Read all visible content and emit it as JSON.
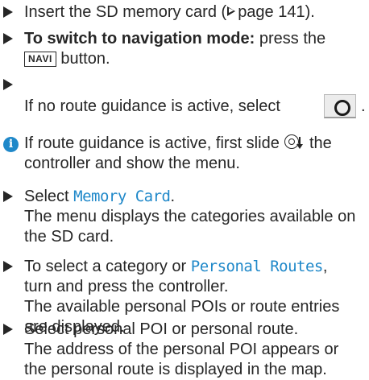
{
  "steps": [
    {
      "text_a": "Insert the SD memory card (",
      "text_b": "page 141)."
    },
    {
      "bold": "To switch to navigation mode:",
      "text_a": "press the",
      "button": "NAVI",
      "text_b": "button."
    },
    {
      "text_a": "If no route guidance is active, select",
      "end": "."
    },
    {
      "text_a": "Select",
      "highlight": "Memory Card",
      "end": ".",
      "line2": "The menu displays the categories available on",
      "line3": "the SD card."
    },
    {
      "text_a": "To select a category or",
      "highlight": "Personal Routes",
      "end": ",",
      "line2": "turn and press the controller.",
      "line3": "The available personal POIs or route entries",
      "line4": "are displayed."
    },
    {
      "text_a": "Select personal POI or personal route.",
      "line2": "The address of the personal POI appears or",
      "line3": "the personal route is displayed in the map."
    }
  ],
  "note": {
    "text_a": "If route guidance is active, first slide",
    "text_b": "the",
    "line2": "controller and show the menu."
  },
  "colors": {
    "accent": "#1f88c9",
    "text": "#262626"
  },
  "icons": [
    "step-bullet-icon",
    "page-reference-icon",
    "route-guidance-button-icon",
    "info-icon",
    "controller-slide-down-icon"
  ]
}
